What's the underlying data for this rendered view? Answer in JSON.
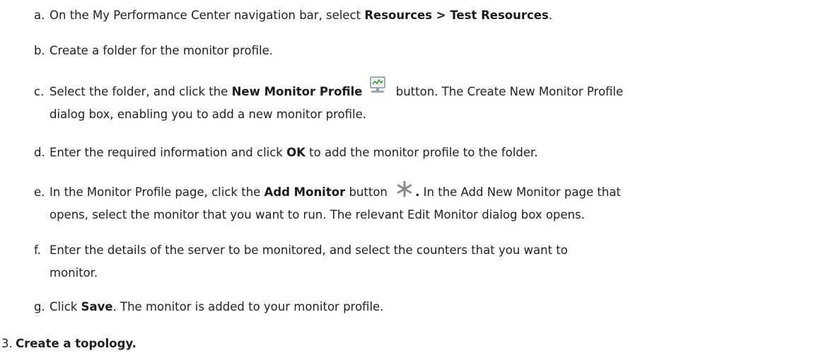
{
  "steps": [
    {
      "marker": "a.",
      "parts": [
        "On the My Performance Center navigation bar, select ",
        "Resources > Test Resources",
        "."
      ]
    },
    {
      "marker": "b.",
      "text": "Create a folder for the monitor profile."
    },
    {
      "marker": "c.",
      "parts": [
        "Select the folder, and click the ",
        "New Monitor Profile",
        " button. The Create New Monitor Profile"
      ],
      "line2": "dialog box, enabling you to add a new monitor profile.",
      "icon": "monitor-profile-icon"
    },
    {
      "marker": "d.",
      "parts": [
        "Enter the required information and click ",
        "OK",
        " to add the monitor profile to the folder."
      ]
    },
    {
      "marker": "e.",
      "parts": [
        "In the Monitor Profile page, click the ",
        "Add Monitor",
        " button ",
        ".",
        " In the Add New Monitor page that"
      ],
      "line2": "opens, select the monitor that you want to run. The relevant Edit Monitor dialog box opens.",
      "icon": "asterisk-icon"
    },
    {
      "marker": "f.",
      "text": "Enter the details of the server to be monitored, and select the counters that you want to",
      "line2": "monitor."
    },
    {
      "marker": "g.",
      "parts": [
        "Click ",
        "Save",
        ". The monitor is added to your monitor profile."
      ]
    }
  ],
  "next_step": {
    "marker": "3.",
    "text": "Create a topology."
  }
}
